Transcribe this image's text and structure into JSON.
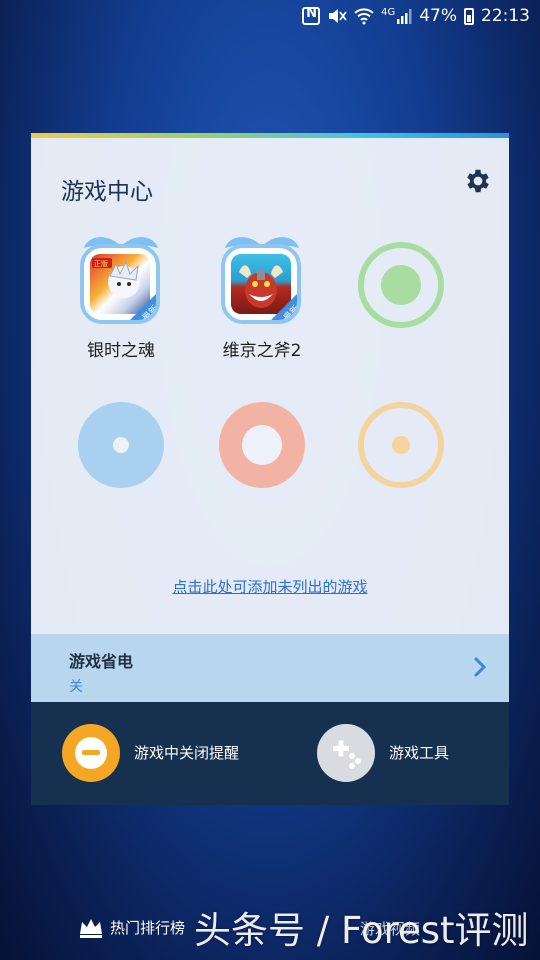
{
  "status_bar": {
    "network": "4G",
    "battery_percent": "47%",
    "battery_level": 0.47,
    "time": "22:13",
    "icons": [
      "nfc-icon",
      "mute-icon",
      "wifi-icon",
      "signal-icon",
      "battery-icon"
    ]
  },
  "game_center": {
    "title": "游戏中心",
    "settings_icon": "gear-icon",
    "games": [
      {
        "name": "银时之魂",
        "badge": "最新",
        "icon": "gintama-game-icon"
      },
      {
        "name": "维京之斧2",
        "badge": "最新",
        "icon": "viking-axe-game-icon"
      }
    ],
    "placeholder_colors": [
      "#a8dca0",
      "#a9d0ef",
      "#f2b3a5",
      "#f4d49c"
    ],
    "add_link": "点击此处可添加未列出的游戏"
  },
  "power_saving": {
    "title": "游戏省电",
    "state": "关"
  },
  "bottom_actions": [
    {
      "label": "游戏中关闭提醒",
      "icon": "minus-circle-icon",
      "color": "#f5a623"
    },
    {
      "label": "游戏工具",
      "icon": "gamepad-icon",
      "color": "#d8dbe0"
    }
  ],
  "footer": {
    "left_label": "热门排行榜",
    "right_label": "游戏视频"
  },
  "watermark": "头条号 / Forest评测"
}
